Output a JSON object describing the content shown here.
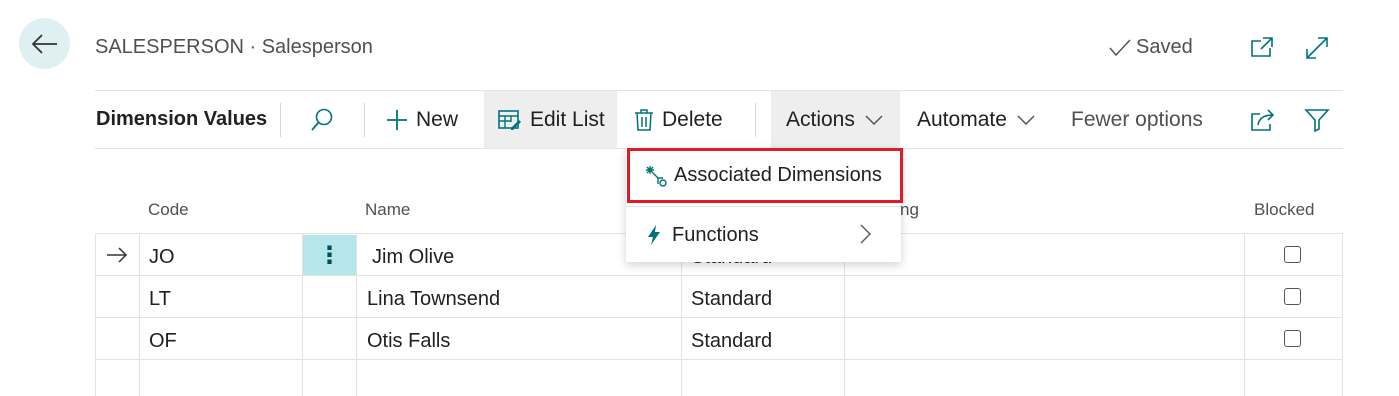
{
  "header": {
    "title": "SALESPERSON · Salesperson",
    "saved_label": "Saved"
  },
  "toolbar": {
    "page_title": "Dimension Values",
    "new_label": "New",
    "edit_list_label": "Edit List",
    "delete_label": "Delete",
    "actions_label": "Actions",
    "automate_label": "Automate",
    "fewer_options_label": "Fewer options"
  },
  "actions_menu": {
    "items": [
      {
        "label": "Associated Dimensions",
        "icon": "associated-dimensions-icon"
      },
      {
        "label": "Functions",
        "icon": "lightning-icon",
        "has_submenu": true
      }
    ]
  },
  "table": {
    "columns": {
      "code": "Code",
      "name": "Name",
      "posting_partial": "ng",
      "blocked": "Blocked"
    },
    "rows": [
      {
        "code": "JO",
        "name": "Jim Olive",
        "posting": "Standard",
        "blocked": false,
        "selected": true
      },
      {
        "code": "LT",
        "name": "Lina Townsend",
        "posting": "Standard",
        "blocked": false
      },
      {
        "code": "OF",
        "name": "Otis Falls",
        "posting": "Standard",
        "blocked": false
      }
    ]
  },
  "colors": {
    "accent": "#00737c",
    "back_button_bg": "#dff0f2",
    "row_menu_bg": "#b4e6ea",
    "highlight_border": "#e01b24"
  }
}
